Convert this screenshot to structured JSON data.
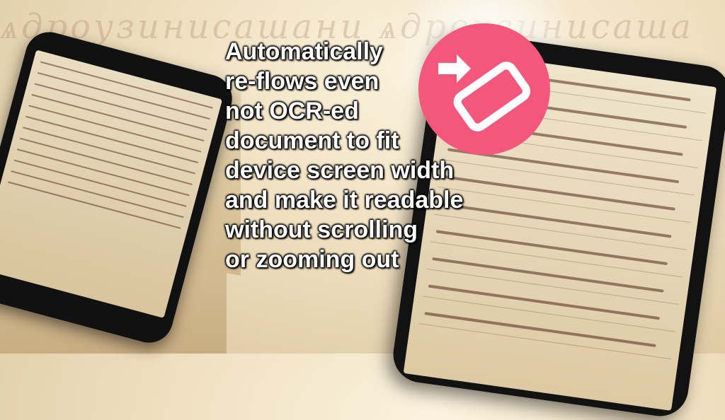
{
  "headline": {
    "lines": "Automatically\nre-flows even\nnot OCR-ed\ndocument to fit\ndevice screen width\nand make it readable\nwithout scrolling\nor zooming out"
  },
  "icon": {
    "name": "reflow-rotate-icon",
    "background": "#f4577c",
    "foreground": "#ffffff"
  },
  "colors": {
    "text": "#ffffff",
    "text_outline": "#000000",
    "parchment": "#e9dcc0",
    "phone": "#121212"
  }
}
